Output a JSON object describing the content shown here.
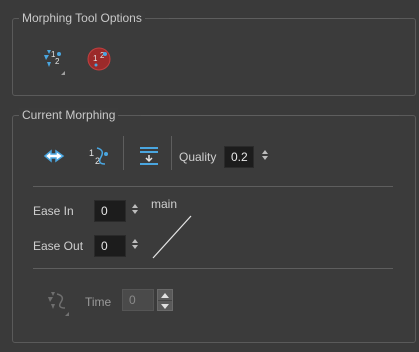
{
  "morphing_tool_options": {
    "title": "Morphing Tool Options",
    "icons": [
      "create-hint-icon",
      "delete-hint-icon"
    ]
  },
  "current_morphing": {
    "title": "Current Morphing",
    "quality_label": "Quality",
    "quality_value": "0.2",
    "ease_in_label": "Ease In",
    "ease_in_value": "0",
    "ease_out_label": "Ease Out",
    "ease_out_value": "0",
    "curve_label": "main",
    "time_label": "Time",
    "time_value": "0"
  },
  "colors": {
    "accent_blue": "#4aa6e0",
    "delete_red": "#9b2a2a"
  }
}
